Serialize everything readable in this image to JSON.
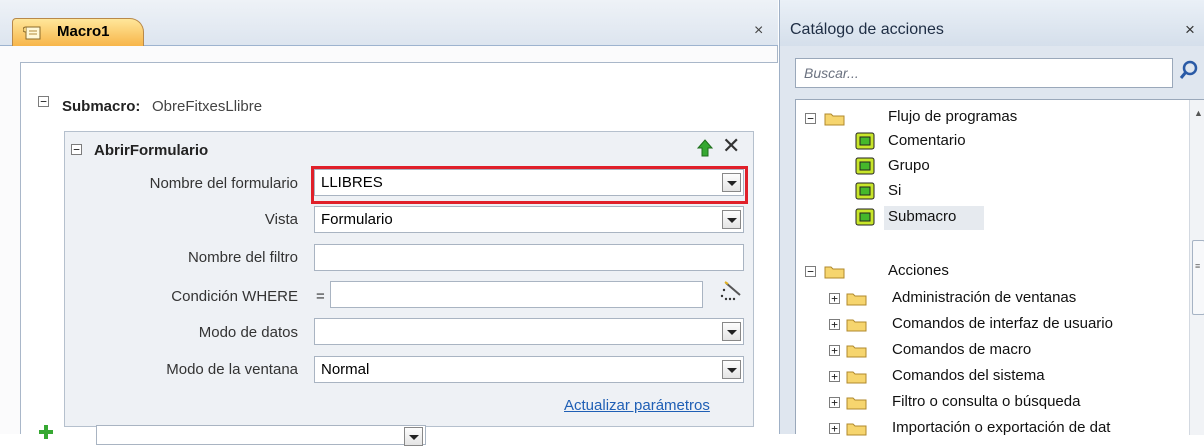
{
  "macro_tab": {
    "label": "Macro1",
    "close": "×"
  },
  "submacro": {
    "toggle": "−",
    "keyword": "Submacro:",
    "name": "ObreFitxesLlibre"
  },
  "action": {
    "toggle": "−",
    "title": "AbrirFormulario",
    "close": "✕",
    "arguments": [
      {
        "label": "Nombre del formulario",
        "value": "LLIBRES"
      },
      {
        "label": "Vista",
        "value": "Formulario"
      },
      {
        "label": "Nombre del filtro",
        "value": ""
      },
      {
        "label": "Condición WHERE",
        "value": ""
      },
      {
        "label": "Modo de datos",
        "value": ""
      },
      {
        "label": "Modo de la ventana",
        "value": "Normal"
      }
    ],
    "where_prefix": "=",
    "update_link": "Actualizar parámetros"
  },
  "catalog": {
    "title": "Catálogo de acciones",
    "close": "×",
    "search_placeholder": "Buscar...",
    "flow_group": {
      "toggle": "−",
      "label": "Flujo de programas",
      "items": [
        "Comentario",
        "Grupo",
        "Si",
        "Submacro"
      ]
    },
    "actions_group": {
      "toggle": "−",
      "label": "Acciones",
      "items": [
        "Administración de ventanas",
        "Comandos de interfaz de usuario",
        "Comandos de macro",
        "Comandos del sistema",
        "Filtro o consulta o búsqueda",
        "Importación o exportación de dat"
      ],
      "item_toggle": "+"
    }
  },
  "colors": {
    "highlight": "#e0202a",
    "link": "#1f5fb5",
    "tab": "#f7b54a"
  }
}
